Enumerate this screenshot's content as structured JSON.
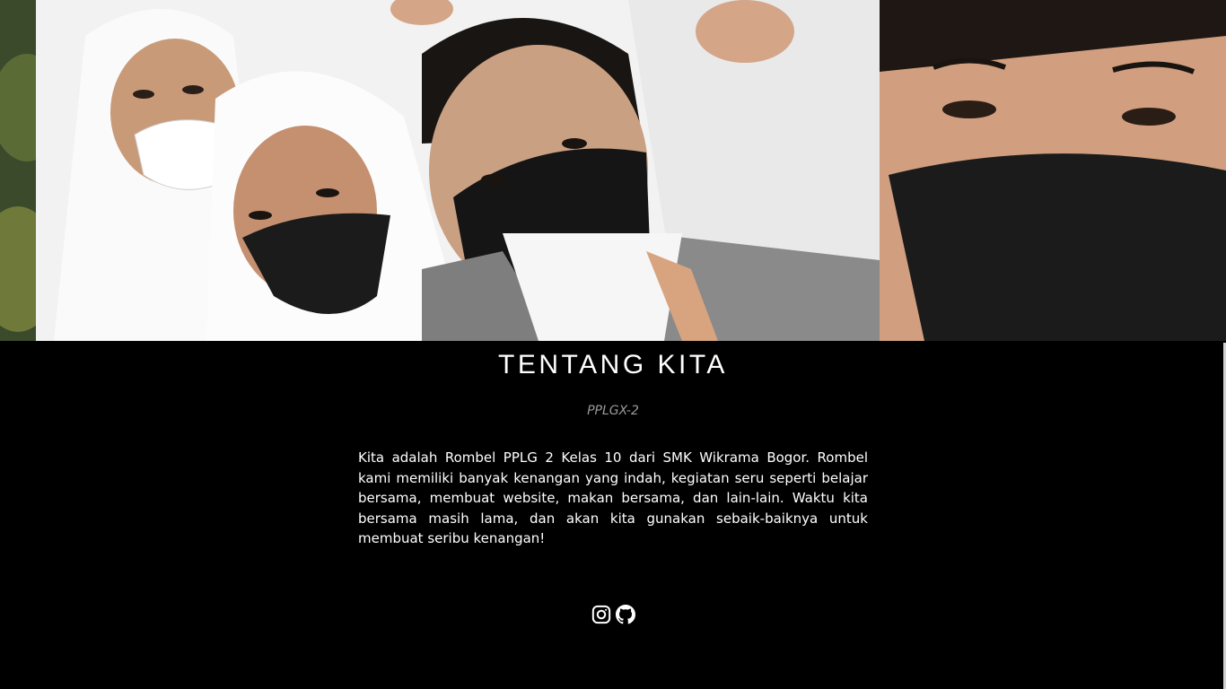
{
  "hero": {
    "image_alt": ""
  },
  "about": {
    "title": "TENTANG KITA",
    "subtitle": "PPLGX-2",
    "description": "Kita adalah Rombel PPLG 2 Kelas 10 dari SMK Wikrama Bogor. Rombel kami memiliki banyak kenangan yang indah, kegiatan seru seperti belajar bersama, membuat website, makan bersama, dan lain-lain. Waktu kita bersama masih lama, dan akan kita gunakan sebaik-baiknya untuk membuat seribu kenangan!"
  },
  "social": {
    "items": [
      {
        "icon": "instagram-icon"
      },
      {
        "icon": "github-icon"
      }
    ]
  },
  "colors": {
    "background": "#000000",
    "text": "#ffffff",
    "subtitle": "#9a9a9a"
  }
}
